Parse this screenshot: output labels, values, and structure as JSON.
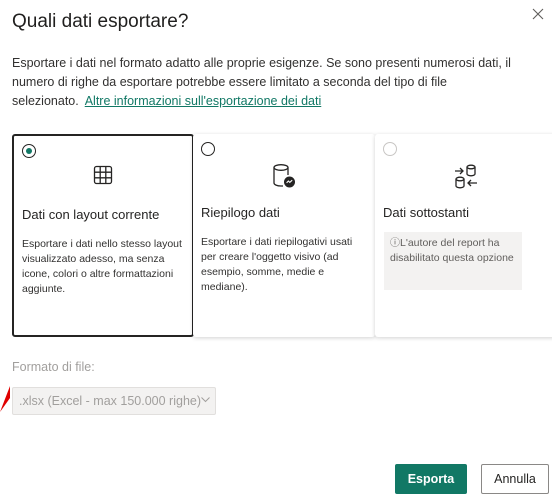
{
  "dialog": {
    "title": "Quali dati esportare?",
    "description": "Esportare i dati nel formato adatto alle proprie esigenze. Se sono presenti numerosi dati, il numero di righe da esportare potrebbe essere limitato a seconda del tipo di file selezionato.",
    "learn_more_link": "Altre informazioni sull'esportazione dei dati"
  },
  "options": [
    {
      "title": "Dati con layout corrente",
      "description": "Esportare i dati nello stesso layout visualizzato adesso, ma senza icone, colori o altre formattazioni aggiunte.",
      "selected": true,
      "icon": "table-icon"
    },
    {
      "title": "Riepilogo dati",
      "description": "Esportare i dati riepilogativi usati per creare l'oggetto visivo (ad esempio, somme, medie e mediane).",
      "selected": false,
      "icon": "database-summary-icon"
    },
    {
      "title": "Dati sottostanti",
      "warning_icon": "ⓘ",
      "warning": "L'autore del report ha disabilitato questa opzione",
      "selected": false,
      "disabled": true,
      "icon": "data-exchange-icon"
    }
  ],
  "file_format": {
    "label": "Formato di file:",
    "value": ".xlsx (Excel - max 150.000 righe)"
  },
  "buttons": {
    "export": "Esporta",
    "cancel": "Annulla"
  },
  "colors": {
    "accent": "#117865",
    "annotation_arrow": "#e00000"
  }
}
